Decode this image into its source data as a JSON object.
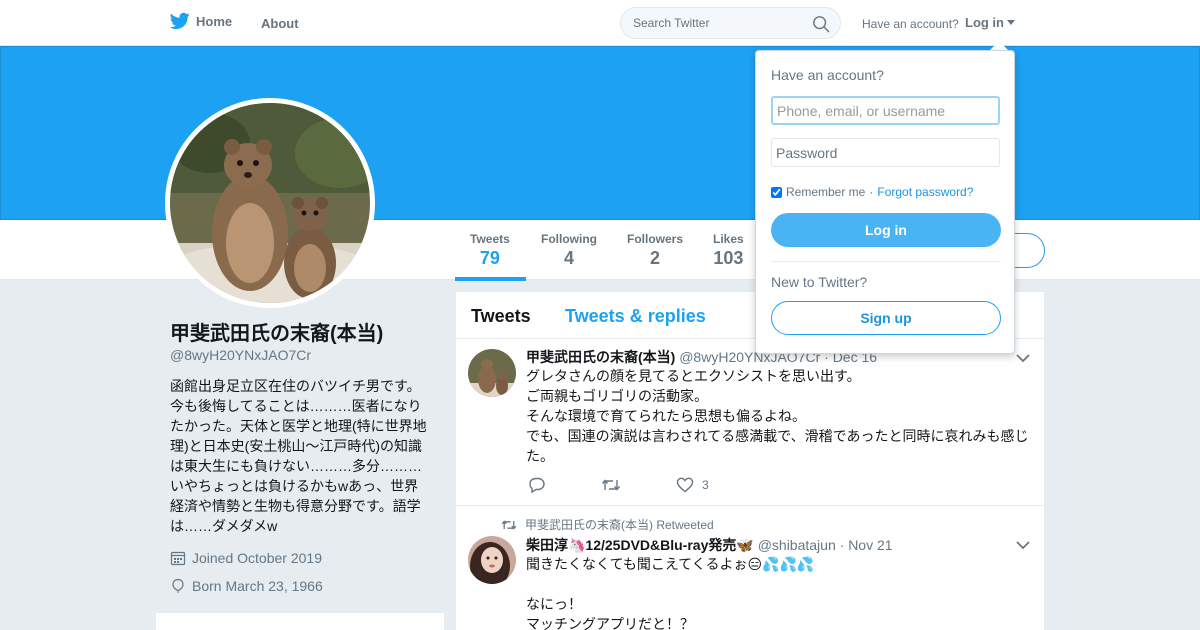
{
  "nav": {
    "home_label": "Home",
    "about_label": "About",
    "search_placeholder": "Search Twitter",
    "have_account": "Have an account?",
    "login_label": "Log in",
    "brand_color": "#1da1f2"
  },
  "profile": {
    "name": "甲斐武田氏の末裔(本当)",
    "handle": "@8wyH20YNxJAO7Cr",
    "bio": "函館出身足立区在住のバツイチ男です。今も後悔してることは………医者になりたかった。天体と医学と地理(特に世界地理)と日本史(安土桃山～江戸時代)の知識は東大生にも負けない………多分………いやちょっとは負けるかもwあっ、世界経済や情勢と生物も得意分野です。語学は……ダメダメw",
    "joined": "Joined October 2019",
    "born": "Born March 23, 1966"
  },
  "stats": {
    "tweets_label": "Tweets",
    "tweets_value": "79",
    "following_label": "Following",
    "following_value": "4",
    "followers_label": "Followers",
    "followers_value": "2",
    "likes_label": "Likes",
    "likes_value": "103"
  },
  "timeline": {
    "tab_tweets": "Tweets",
    "tab_replies": "Tweets & replies",
    "tweets": [
      {
        "name": "甲斐武田氏の末裔(本当)",
        "handle": "@8wyH20YNxJAO7Cr",
        "date": "· Dec 16",
        "lines": [
          "グレタさんの顔を見てるとエクソシストを思い出す。",
          "ご両親もゴリゴリの活動家。",
          "そんな環境で育てられたら思想も偏るよね。",
          "でも、国連の演説は言わされてる感満載で、滑稽であったと同時に哀れみも感じた。"
        ],
        "like_count": "3"
      },
      {
        "retweet_note": "甲斐武田氏の末裔(本当) Retweeted",
        "name": "柴田淳🦄12/25DVD&Blu-ray発売🦋",
        "handle": "@shibatajun",
        "date": "· Nov 21",
        "lines": [
          "聞きたくなくても聞こえてくるよぉ😑💦💦💦",
          "",
          "なにっ！",
          "マッチングアプリだと！？"
        ]
      }
    ]
  },
  "login_dropdown": {
    "title": "Have an account?",
    "username_placeholder": "Phone, email, or username",
    "password_placeholder": "Password",
    "remember_label": "Remember me",
    "forgot_label": "Forgot password?",
    "login_button": "Log in",
    "new_to": "New to Twitter?",
    "signup_button": "Sign up"
  }
}
